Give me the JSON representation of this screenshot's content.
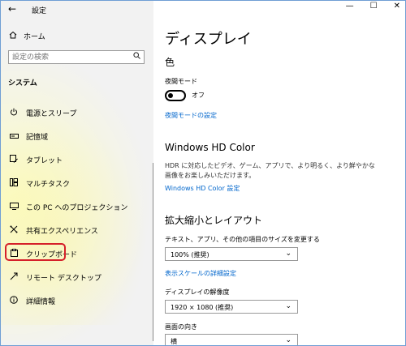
{
  "window": {
    "app_title": "設定",
    "minimize": "—",
    "maximize": "☐",
    "close": "✕"
  },
  "nav": {
    "back_glyph": "←",
    "home": {
      "icon": "home-icon",
      "label": "ホーム"
    },
    "search": {
      "placeholder": "設定の検索"
    },
    "section_title": "システム",
    "items": [
      {
        "icon": "power-icon",
        "label": "電源とスリープ"
      },
      {
        "icon": "storage-icon",
        "label": "記憶域"
      },
      {
        "icon": "tablet-icon",
        "label": "タブレット"
      },
      {
        "icon": "multitask-icon",
        "label": "マルチタスク"
      },
      {
        "icon": "projection-icon",
        "label": "この PC へのプロジェクション"
      },
      {
        "icon": "shared-experiences-icon",
        "label": "共有エクスペリエンス"
      },
      {
        "icon": "clipboard-icon",
        "label": "クリップボード",
        "selected": true
      },
      {
        "icon": "remote-desktop-icon",
        "label": "リモート デスクトップ"
      },
      {
        "icon": "info-icon",
        "label": "詳細情報"
      }
    ]
  },
  "main": {
    "title": "ディスプレイ",
    "color_heading": "色",
    "night_light_label": "夜間モード",
    "night_light_state": "オフ",
    "night_light_link": "夜間モードの設定",
    "hdr_heading": "Windows HD Color",
    "hdr_desc": "HDR に対応したビデオ、ゲーム、アプリで、より明るく、より鮮やかな画像をお楽しみいただけます。",
    "hdr_link": "Windows HD Color 設定",
    "scale_heading": "拡大縮小とレイアウト",
    "scale_label": "テキスト、アプリ、その他の項目のサイズを変更する",
    "scale_value": "100% (推奨)",
    "scale_link": "表示スケールの詳細設定",
    "resolution_label": "ディスプレイの解像度",
    "resolution_value": "1920 × 1080 (推奨)",
    "orientation_label": "画面の向き",
    "orientation_value": "横"
  },
  "colors": {
    "link": "#0066cc",
    "highlight_border": "#d5202a",
    "left_pane_bg": "#f2f2f2"
  }
}
